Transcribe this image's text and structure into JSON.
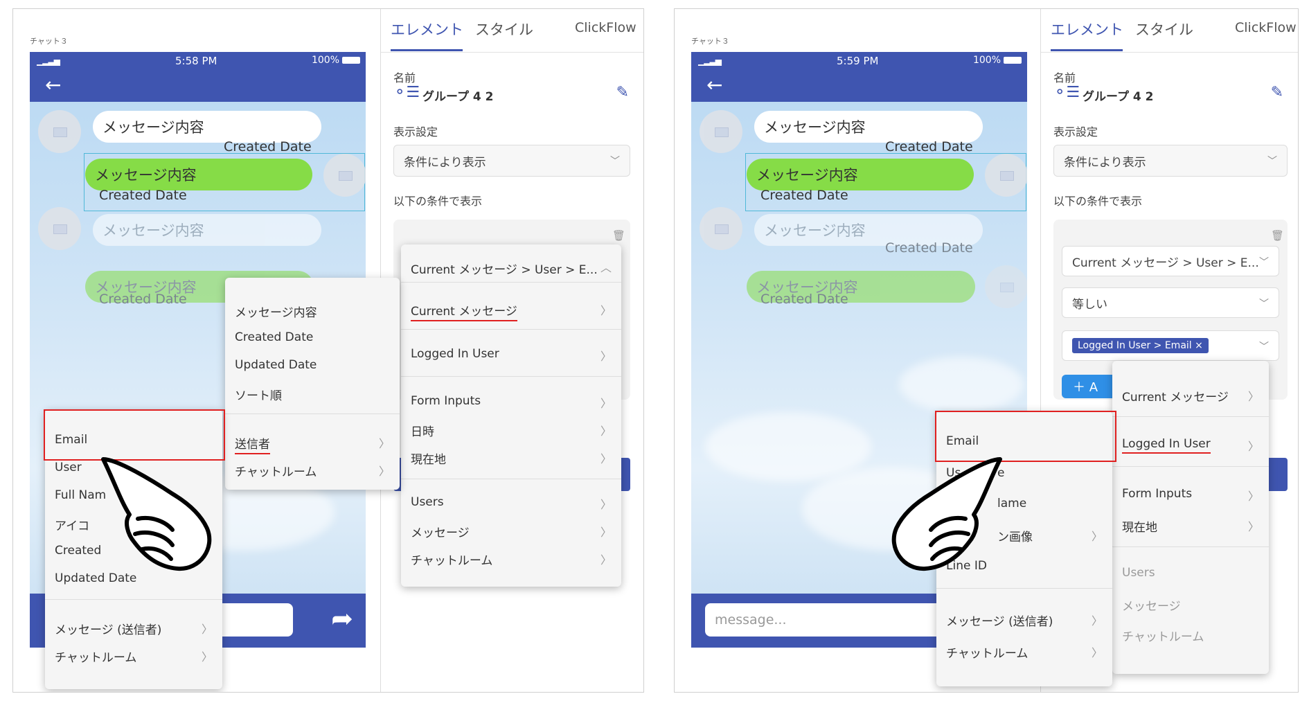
{
  "left": {
    "screen_label": "チャット３",
    "status_bar": {
      "time": "5:58 PM",
      "battery": "100%"
    },
    "messages": [
      {
        "text": "メッセージ内容",
        "date": "Created Date"
      },
      {
        "text": "メッセージ内容",
        "date": "Created Date"
      },
      {
        "text": "メッセージ内容"
      },
      {
        "text": "メッセージ内容",
        "date": "Created Date"
      }
    ],
    "tabs": [
      "エレメント",
      "スタイル",
      "ClickFlow"
    ],
    "name_label": "名前",
    "name_value": "グループ 4 2",
    "display_label": "表示設定",
    "display_value": "条件により表示",
    "condition_label": "以下の条件で表示",
    "condition_menu": {
      "header": "Current メッセージ > User > E...",
      "items": [
        "Current メッセージ",
        "Logged In User",
        "Form Inputs",
        "日時",
        "現在地",
        "Users",
        "メッセージ",
        "チャットルーム"
      ]
    },
    "field_menu": {
      "items": [
        "メッセージ内容",
        "Created Date",
        "Updated Date",
        "ソート順",
        "送信者",
        "チャットルーム"
      ]
    },
    "user_menu": {
      "items": [
        "Email",
        "User",
        "Full Nam",
        "アイコ",
        "Created",
        "Updated Date",
        "メッセージ (送信者)",
        "チャットルーム"
      ]
    }
  },
  "right": {
    "screen_label": "チャット３",
    "status_bar": {
      "time": "5:59 PM",
      "battery": "100%"
    },
    "messages": [
      {
        "text": "メッセージ内容",
        "date": "Created Date"
      },
      {
        "text": "メッセージ内容",
        "date": "Created Date"
      },
      {
        "text": "メッセージ内容",
        "date": "Created Date"
      },
      {
        "text": "メッセージ内容",
        "date": "Created Date"
      }
    ],
    "message_placeholder": "message...",
    "tabs": [
      "エレメント",
      "スタイル",
      "ClickFlow"
    ],
    "name_label": "名前",
    "name_value": "グループ 4 2",
    "display_label": "表示設定",
    "display_value": "条件により表示",
    "condition_label": "以下の条件で表示",
    "condition_select": "Current メッセージ > User > E...",
    "operator_select": "等しい",
    "value_tag": "Logged In User > Email ×",
    "add_button": "＋ A",
    "source_menu": {
      "items": [
        "Current メッセージ",
        "Logged In User",
        "Form Inputs",
        "現在地",
        "Users",
        "メッセージ",
        "チャットルーム"
      ]
    },
    "user_menu": {
      "items": [
        "Email",
        "Us",
        "e",
        "lame",
        "ン画像",
        "Line ID",
        "メッセージ (送信者)",
        "チャットルーム"
      ]
    }
  },
  "icons": {
    "back": "back-arrow-icon",
    "send": "send-icon",
    "trash": "trash-icon",
    "edit": "edit-pencil-icon",
    "group": "group-icon",
    "hand": "pointing-hand-icon",
    "chevron": "chevron-right-icon"
  },
  "colors": {
    "header": "#3f55b0",
    "bubble_green": "#86dc47",
    "highlight_red": "#e02020",
    "selection": "#4fb8d8"
  }
}
